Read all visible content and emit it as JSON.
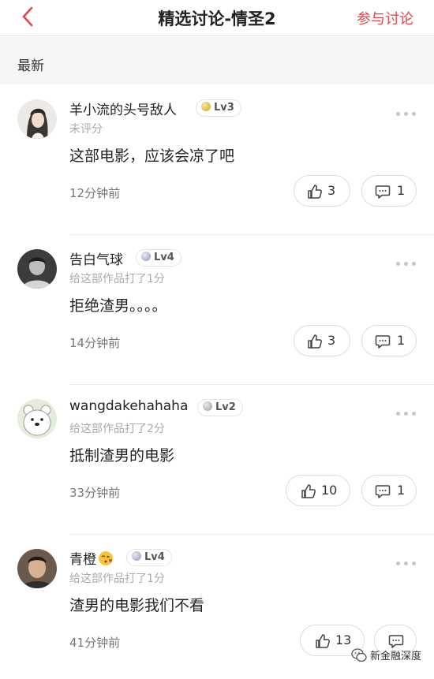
{
  "nav": {
    "title": "精选讨论-情圣2",
    "action_label": "参与讨论",
    "accent_color": "#e2464c"
  },
  "section": {
    "label": "最新"
  },
  "comments": [
    {
      "username": "羊小流的头号敌人",
      "level": "Lv3",
      "rating_text": "未评分",
      "content": "这部电影，应该会凉了吧",
      "time": "12分钟前",
      "likes": "3",
      "replies": "1",
      "avatar_icon": "avatar-girl-illustration"
    },
    {
      "username": "告白气球",
      "level": "Lv4",
      "rating_text": "给这部作品打了1分",
      "content": "拒绝渣男。。。。",
      "time": "14分钟前",
      "likes": "3",
      "replies": "1",
      "avatar_icon": "avatar-bw-photo"
    },
    {
      "username": "wangdakehahaha",
      "level": "Lv2",
      "rating_text": "给这部作品打了2分",
      "content": "抵制渣男的电影",
      "time": "33分钟前",
      "likes": "10",
      "replies": "1",
      "avatar_icon": "avatar-white-bear"
    },
    {
      "username": "青橙",
      "level": "Lv4",
      "rating_text": "给这部作品打了1分",
      "content": "渣男的电影我们不看",
      "time": "41分钟前",
      "likes": "13",
      "replies": "",
      "avatar_icon": "avatar-man-photo",
      "name_emoji": "kiss-emoji-icon"
    }
  ],
  "watermark": {
    "text": "新金融深度"
  }
}
